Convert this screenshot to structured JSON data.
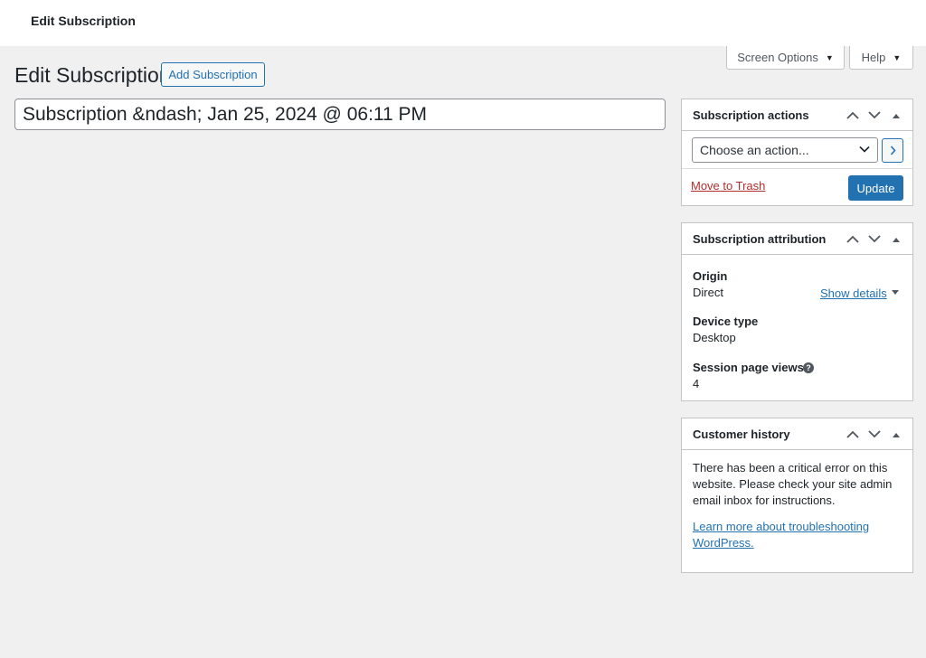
{
  "topbar": {
    "title": "Edit Subscription"
  },
  "screen_meta": {
    "screen_options_label": "Screen Options",
    "help_label": "Help"
  },
  "page": {
    "heading": "Edit Subscription",
    "add_button_label": "Add Subscription",
    "title_value": "Subscription &ndash; Jan 25, 2024 @ 06:11 PM"
  },
  "actions_box": {
    "title": "Subscription actions",
    "select_value": "Choose an action...",
    "trash_label": "Move to Trash",
    "update_label": "Update"
  },
  "attribution_box": {
    "title": "Subscription attribution",
    "origin_label": "Origin",
    "origin_value": "Direct",
    "show_details_label": "Show details",
    "device_label": "Device type",
    "device_value": "Desktop",
    "session_label": "Session page views",
    "session_value": "4"
  },
  "history_box": {
    "title": "Customer history",
    "error_text": "There has been a critical error on this website. Please check your site admin email inbox for instructions.",
    "learn_link": "Learn more about troubleshooting WordPress."
  },
  "colors": {
    "background": "#f0f0f1",
    "primary": "#2271b1",
    "danger": "#b32d2e",
    "border": "#c3c4c7"
  },
  "icons": [
    "chevron-up-icon",
    "chevron-down-icon",
    "triangle-up-icon",
    "caret-down-icon",
    "chevron-right-icon",
    "help-icon"
  ]
}
